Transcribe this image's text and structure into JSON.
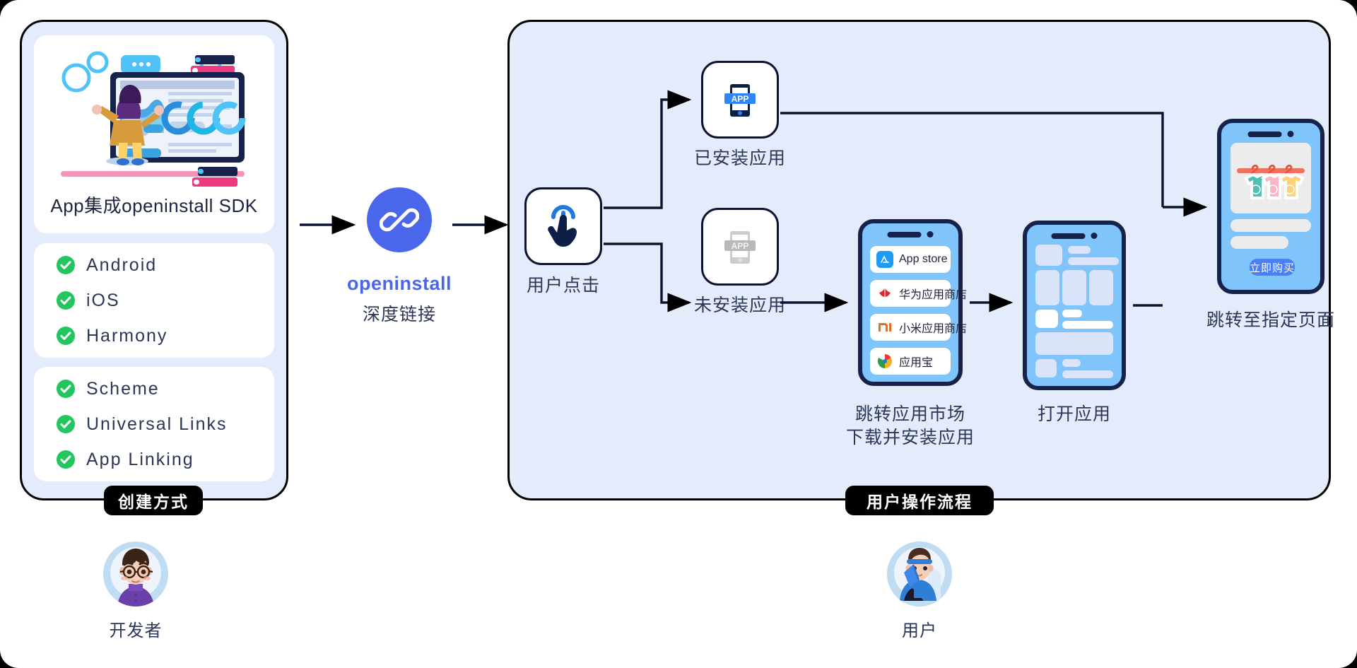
{
  "diagram": {
    "left_panel": {
      "badge": "创建方式",
      "sdk_card_title": "App集成openinstall SDK",
      "platforms": [
        "Android",
        "iOS",
        "Harmony"
      ],
      "link_types": [
        "Scheme",
        "Universal Links",
        "App Linking"
      ],
      "role_label": "开发者"
    },
    "center": {
      "brand": "openinstall",
      "brand_sub": "深度链接"
    },
    "right_panel": {
      "badge": "用户操作流程",
      "role_label": "用户",
      "nodes": {
        "click": "用户点击",
        "installed": "已安装应用",
        "not_installed": "未安装应用",
        "market": "跳转应用市场\n下载并安装应用",
        "market_line1": "跳转应用市场",
        "market_line2": "下载并安装应用",
        "open_app": "打开应用",
        "target_page": "跳转至指定页面"
      },
      "app_stores": [
        {
          "name": "App store",
          "icon": "appstore-icon",
          "color": "#1e9cf5"
        },
        {
          "name": "华为应用商店",
          "icon": "huawei-icon",
          "color": "#e8262b"
        },
        {
          "name": "小米应用商店",
          "icon": "xiaomi-icon",
          "color": "#f26b1d"
        },
        {
          "name": "应用宝",
          "icon": "yingyongbao-icon",
          "color": "#2f9b4e"
        }
      ],
      "phone_app_badge": "APP",
      "buy_button": "立即购买"
    },
    "colors": {
      "panel_bg": "#e4ebfb",
      "brand_blue": "#4a66eb",
      "check_green": "#22c55e",
      "ink": "#2c3656",
      "phone_blue": "#7fc4fb",
      "phone_frame": "#17224a"
    }
  }
}
